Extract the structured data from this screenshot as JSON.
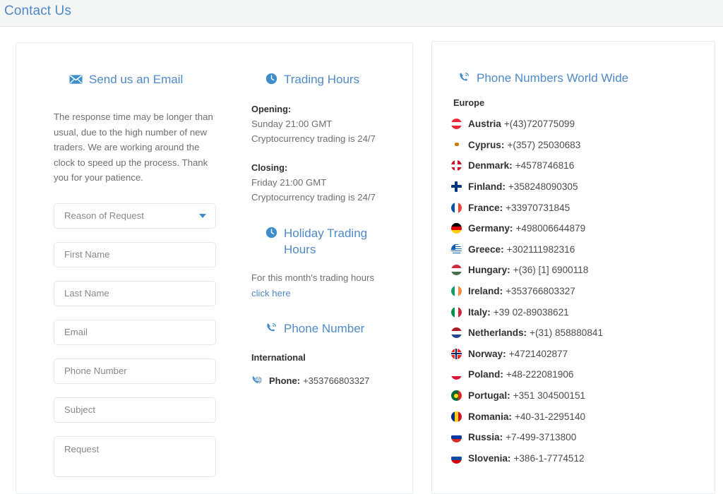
{
  "header": {
    "title": "Contact Us"
  },
  "email": {
    "heading": "Send us an Email",
    "icon": "envelope-icon",
    "blurb": "The response time may be longer than usual, due to the high number of new traders. We are working around the clock to speed up the process. Thank you for your patience.",
    "fields": {
      "reason_placeholder": "Reason of Request",
      "first_name_placeholder": "First Name",
      "last_name_placeholder": "Last Name",
      "email_placeholder": "Email",
      "phone_placeholder": "Phone Number",
      "subject_placeholder": "Subject",
      "request_placeholder": "Request"
    }
  },
  "hours": {
    "heading": "Trading Hours",
    "icon": "clock-icon",
    "opening_label": "Opening:",
    "opening_line1": "Sunday 21:00 GMT",
    "opening_line2": "Cryptocurrency trading is 24/7",
    "closing_label": "Closing:",
    "closing_line1": "Friday 21:00 GMT",
    "closing_line2": "Cryptocurrency trading is 24/7",
    "holiday_heading": "Holiday Trading Hours",
    "holiday_note": "For this month's trading hours",
    "holiday_link": "click here",
    "phone_heading": "Phone Number",
    "phone_icon": "phone-icon",
    "international_label": "International",
    "international_phone_label": "Phone:",
    "international_phone_value": "+353766803327",
    "international_phone_icon": "phone-globe-icon"
  },
  "world": {
    "heading": "Phone Numbers World Wide",
    "icon": "phone-icon",
    "region": "Europe",
    "countries": [
      {
        "flag": "austria-flag-icon",
        "name": "Austria",
        "number": "+(43)720775099"
      },
      {
        "flag": "cyprus-flag-icon",
        "name": "Cyprus:",
        "number": " +(357) 25030683"
      },
      {
        "flag": "denmark-flag-icon",
        "name": "Denmark:",
        "number": "+4578746816"
      },
      {
        "flag": "finland-flag-icon",
        "name": "Finland:",
        "number": "+358248090305"
      },
      {
        "flag": "france-flag-icon",
        "name": "France:",
        "number": "+33970731845"
      },
      {
        "flag": "germany-flag-icon",
        "name": "Germany:",
        "number": "+498006644879"
      },
      {
        "flag": "greece-flag-icon",
        "name": "Greece:",
        "number": "+302111982316"
      },
      {
        "flag": "hungary-flag-icon",
        "name": "Hungary:",
        "number": "+(36) [1] 6900118"
      },
      {
        "flag": "ireland-flag-icon",
        "name": "Ireland:",
        "number": "+353766803327"
      },
      {
        "flag": "italy-flag-icon",
        "name": "Italy:",
        "number": "+39 02-89038621"
      },
      {
        "flag": "netherlands-flag-icon",
        "name": "Netherlands:",
        "number": "+(31) 858880841"
      },
      {
        "flag": "norway-flag-icon",
        "name": "Norway:",
        "number": "+4721402877"
      },
      {
        "flag": "poland-flag-icon",
        "name": "Poland:",
        "number": "+48-222081906"
      },
      {
        "flag": "portugal-flag-icon",
        "name": "Portugal:",
        "number": "+351 304500151"
      },
      {
        "flag": "romania-flag-icon",
        "name": "Romania:",
        "number": "+40-31-2295140"
      },
      {
        "flag": "russia-flag-icon",
        "name": "Russia:",
        "number": "+7-499-3713800"
      },
      {
        "flag": "slovenia-flag-icon",
        "name": "Slovenia:",
        "number": "+386-1-7774512"
      }
    ]
  },
  "colors": {
    "accent_blue": "#4e8ac8",
    "header_bg": "#f4f6f6",
    "text_gray": "#6d6f72",
    "text_dark": "#2f3133",
    "border": "#e9ecee"
  }
}
